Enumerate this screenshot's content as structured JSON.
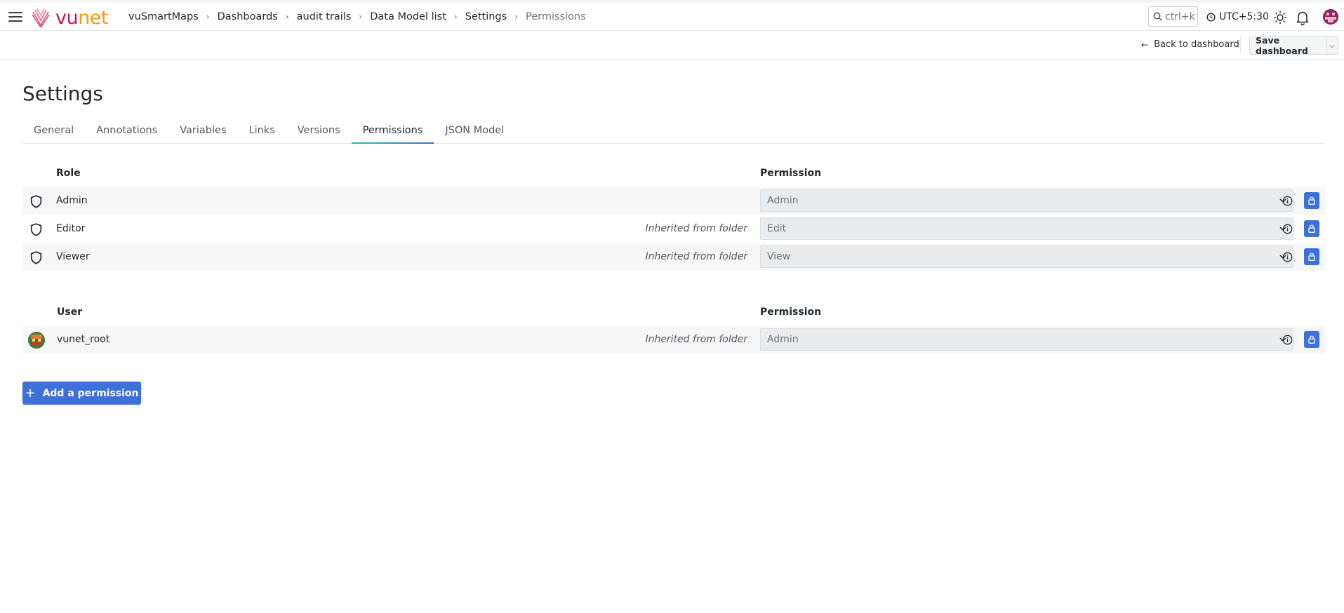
{
  "app": {
    "logo_text_a": "vu",
    "logo_text_b": "net"
  },
  "breadcrumb": [
    "vuSmartMaps",
    "Dashboards",
    "audit trails",
    "Data Model list",
    "Settings",
    "Permissions"
  ],
  "topbar": {
    "search_label": "ctrl+k",
    "timezone": "UTC+5:30"
  },
  "toolbar": {
    "back_label": "Back to dashboard",
    "save_label": "Save dashboard"
  },
  "page": {
    "title": "Settings"
  },
  "tabs": [
    "General",
    "Annotations",
    "Variables",
    "Links",
    "Versions",
    "Permissions",
    "JSON Model"
  ],
  "active_tab": "Permissions",
  "roles": {
    "header_name": "Role",
    "header_permission": "Permission",
    "rows": [
      {
        "name": "Admin",
        "inherited": "",
        "permission": "Admin"
      },
      {
        "name": "Editor",
        "inherited": "Inherited from folder",
        "permission": "Edit"
      },
      {
        "name": "Viewer",
        "inherited": "Inherited from folder",
        "permission": "View"
      }
    ]
  },
  "users": {
    "header_name": "User",
    "header_permission": "Permission",
    "rows": [
      {
        "name": "vunet_root",
        "inherited": "Inherited from folder",
        "permission": "Admin"
      }
    ]
  },
  "add_button_label": "Add a permission",
  "colors": {
    "primary": "#3d71d9",
    "logo_pink": "#c2185b",
    "logo_orange": "#f39c12"
  }
}
